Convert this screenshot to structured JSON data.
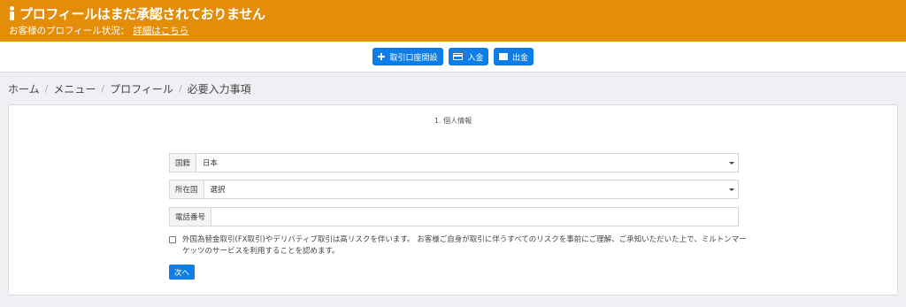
{
  "banner": {
    "title": "プロフィールはまだ承認されておりません",
    "status_label": "お客様のプロフィール状況：",
    "details_link": "詳細はこちら"
  },
  "toolbar": {
    "open_account_label": "取引口座開設",
    "deposit_label": "入金",
    "withdraw_label": "出金"
  },
  "breadcrumb": [
    "ホーム",
    "メニュー",
    "プロフィール",
    "必要入力事項"
  ],
  "form": {
    "step_title": "1. 個人情報",
    "nationality_label": "国籍",
    "nationality_value": "日本",
    "country_label": "所在国",
    "country_value": "選択",
    "phone_label": "電話番号",
    "phone_value": "",
    "consent_text": "外国為替金取引(FX取引)やデリバティブ取引は高リスクを伴います。 お客様ご自身が取引に伴うすべてのリスクを事前にご理解、ご承知いただいた上で、ミルトンマーケッツのサービスを利用することを認めます。",
    "consent_checked": false,
    "next_label": "次へ"
  },
  "colors": {
    "banner_bg": "#e38d08",
    "primary_button": "#0d7ee8",
    "page_bg": "#eef0f3"
  }
}
